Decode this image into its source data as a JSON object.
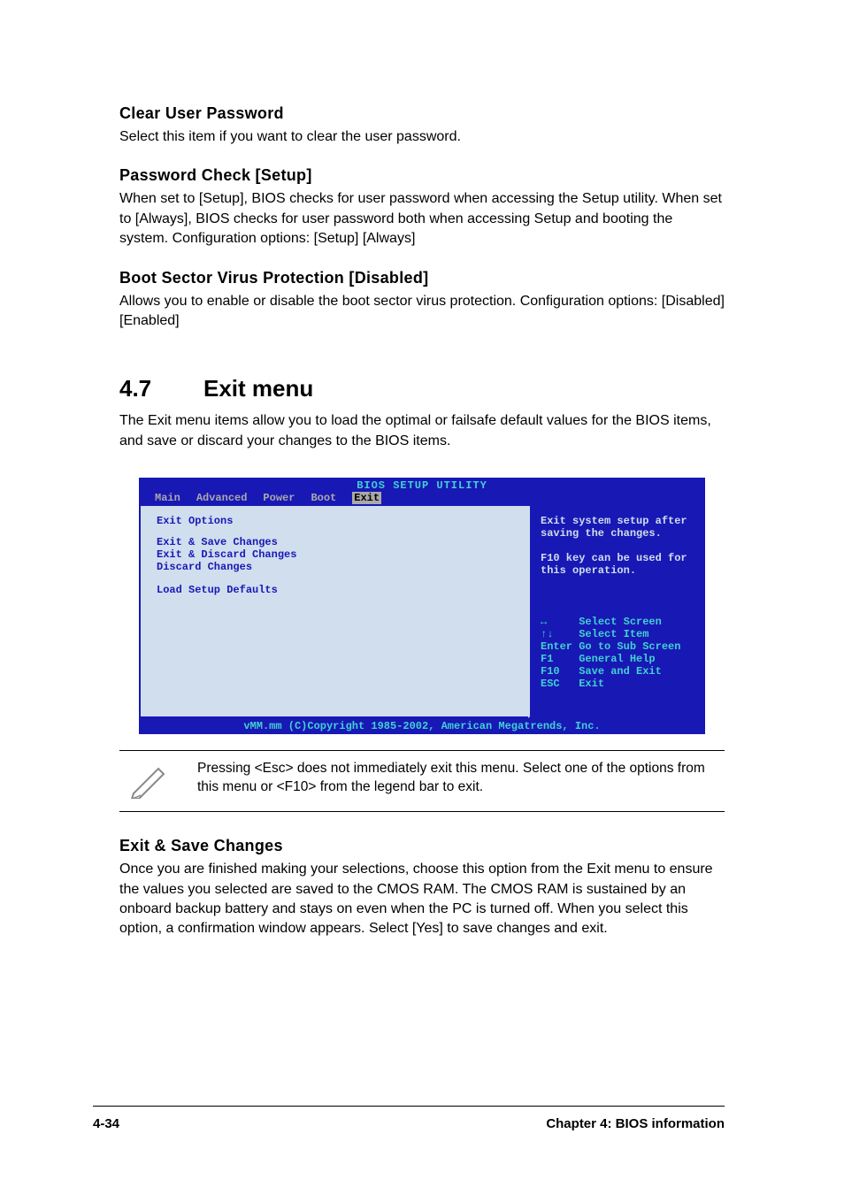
{
  "sections": {
    "s1": {
      "heading": "Clear User Password",
      "body": "Select this item if you want to clear the user password."
    },
    "s2": {
      "heading": "Password Check [Setup]",
      "body": "When set to [Setup], BIOS checks for user password when accessing the Setup utility. When set to [Always], BIOS checks for user password both when accessing Setup and booting the system. Configuration options: [Setup] [Always]"
    },
    "s3": {
      "heading": "Boot Sector Virus Protection [Disabled]",
      "body": "Allows you to enable or disable the boot sector virus protection. Configuration options: [Disabled] [Enabled]"
    }
  },
  "exit_menu": {
    "num": "4.7",
    "title": "Exit menu",
    "intro": "The Exit menu items allow you to load the optimal or failsafe default values for the BIOS items, and save or discard your changes to the BIOS items."
  },
  "bios": {
    "title": "BIOS SETUP UTILITY",
    "tabs": [
      "Main",
      "Advanced",
      "Power",
      "Boot",
      "Exit"
    ],
    "selected_tab": "Exit",
    "left": {
      "heading": "Exit Options",
      "items": [
        "Exit & Save Changes",
        "Exit & Discard Changes",
        "Discard Changes",
        "Load Setup Defaults"
      ]
    },
    "right_help": "Exit system setup after saving the changes.\n\nF10 key can be used for this operation.",
    "nav": [
      {
        "key": "↔",
        "label": "Select Screen"
      },
      {
        "key": "↑↓",
        "label": "Select Item"
      },
      {
        "key": "Enter",
        "label": "Go to Sub Screen"
      },
      {
        "key": "F1",
        "label": "General Help"
      },
      {
        "key": "F10",
        "label": "Save and Exit"
      },
      {
        "key": "ESC",
        "label": "Exit"
      }
    ],
    "footer": "vMM.mm (C)Copyright 1985-2002, American Megatrends, Inc."
  },
  "note": "Pressing <Esc> does not immediately exit this menu. Select one of the options from this menu or <F10> from the legend bar to exit.",
  "exit_save": {
    "heading": "Exit & Save Changes",
    "body": "Once you are finished making your selections, choose this option from the Exit menu to ensure the values you selected are saved to the CMOS RAM. The CMOS RAM is sustained by an onboard backup battery and stays on even when the PC is turned off. When you select this option, a confirmation window appears. Select [Yes] to save changes and exit."
  },
  "page_footer": {
    "page_num": "4-34",
    "chapter": "Chapter 4: BIOS information"
  }
}
